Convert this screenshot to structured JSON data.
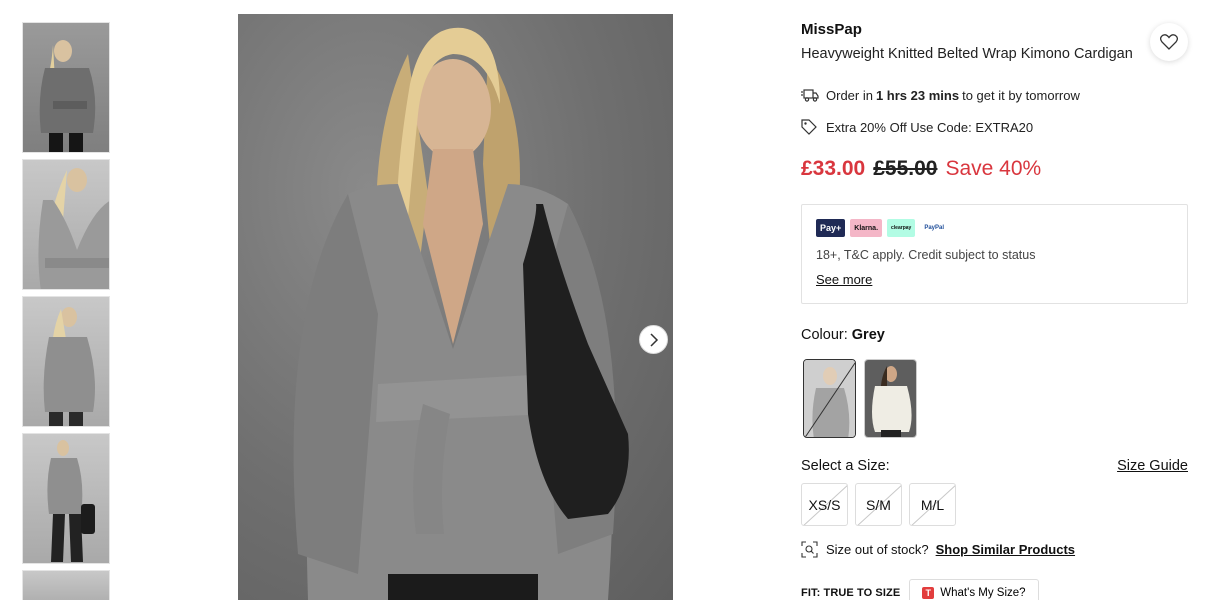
{
  "thumbnails": [
    {
      "alt": "thumbnail-1"
    },
    {
      "alt": "thumbnail-2"
    },
    {
      "alt": "thumbnail-3"
    },
    {
      "alt": "thumbnail-4"
    },
    {
      "alt": "thumbnail-5"
    }
  ],
  "product": {
    "brand": "MissPap",
    "name": "Heavyweight Knitted Belted Wrap Kimono Cardigan"
  },
  "delivery": {
    "prefix": "Order in",
    "time": "1 hrs 23 mins",
    "suffix": "to get it by tomorrow"
  },
  "promo": "Extra 20% Off Use Code: EXTRA20",
  "price": {
    "now": "£33.00",
    "was": "£55.00",
    "save": "Save 40%"
  },
  "payment": {
    "logos": [
      "Pay+",
      "Klarna.",
      "clearpay",
      "PayPal"
    ],
    "terms": "18+, T&C apply. Credit subject to status",
    "more": "See more"
  },
  "colour": {
    "label": "Colour:",
    "value": "Grey"
  },
  "size": {
    "label": "Select a Size:",
    "guide": "Size Guide",
    "options": [
      "XS/S",
      "S/M",
      "M/L"
    ]
  },
  "stock": {
    "text": "Size out of stock?",
    "link": "Shop Similar Products"
  },
  "fit": {
    "label": "FIT: TRUE TO SIZE",
    "button": "What's My Size?"
  },
  "colors": {
    "sale_red": "#d9363e",
    "garment_grey": "#8a8a8a"
  }
}
